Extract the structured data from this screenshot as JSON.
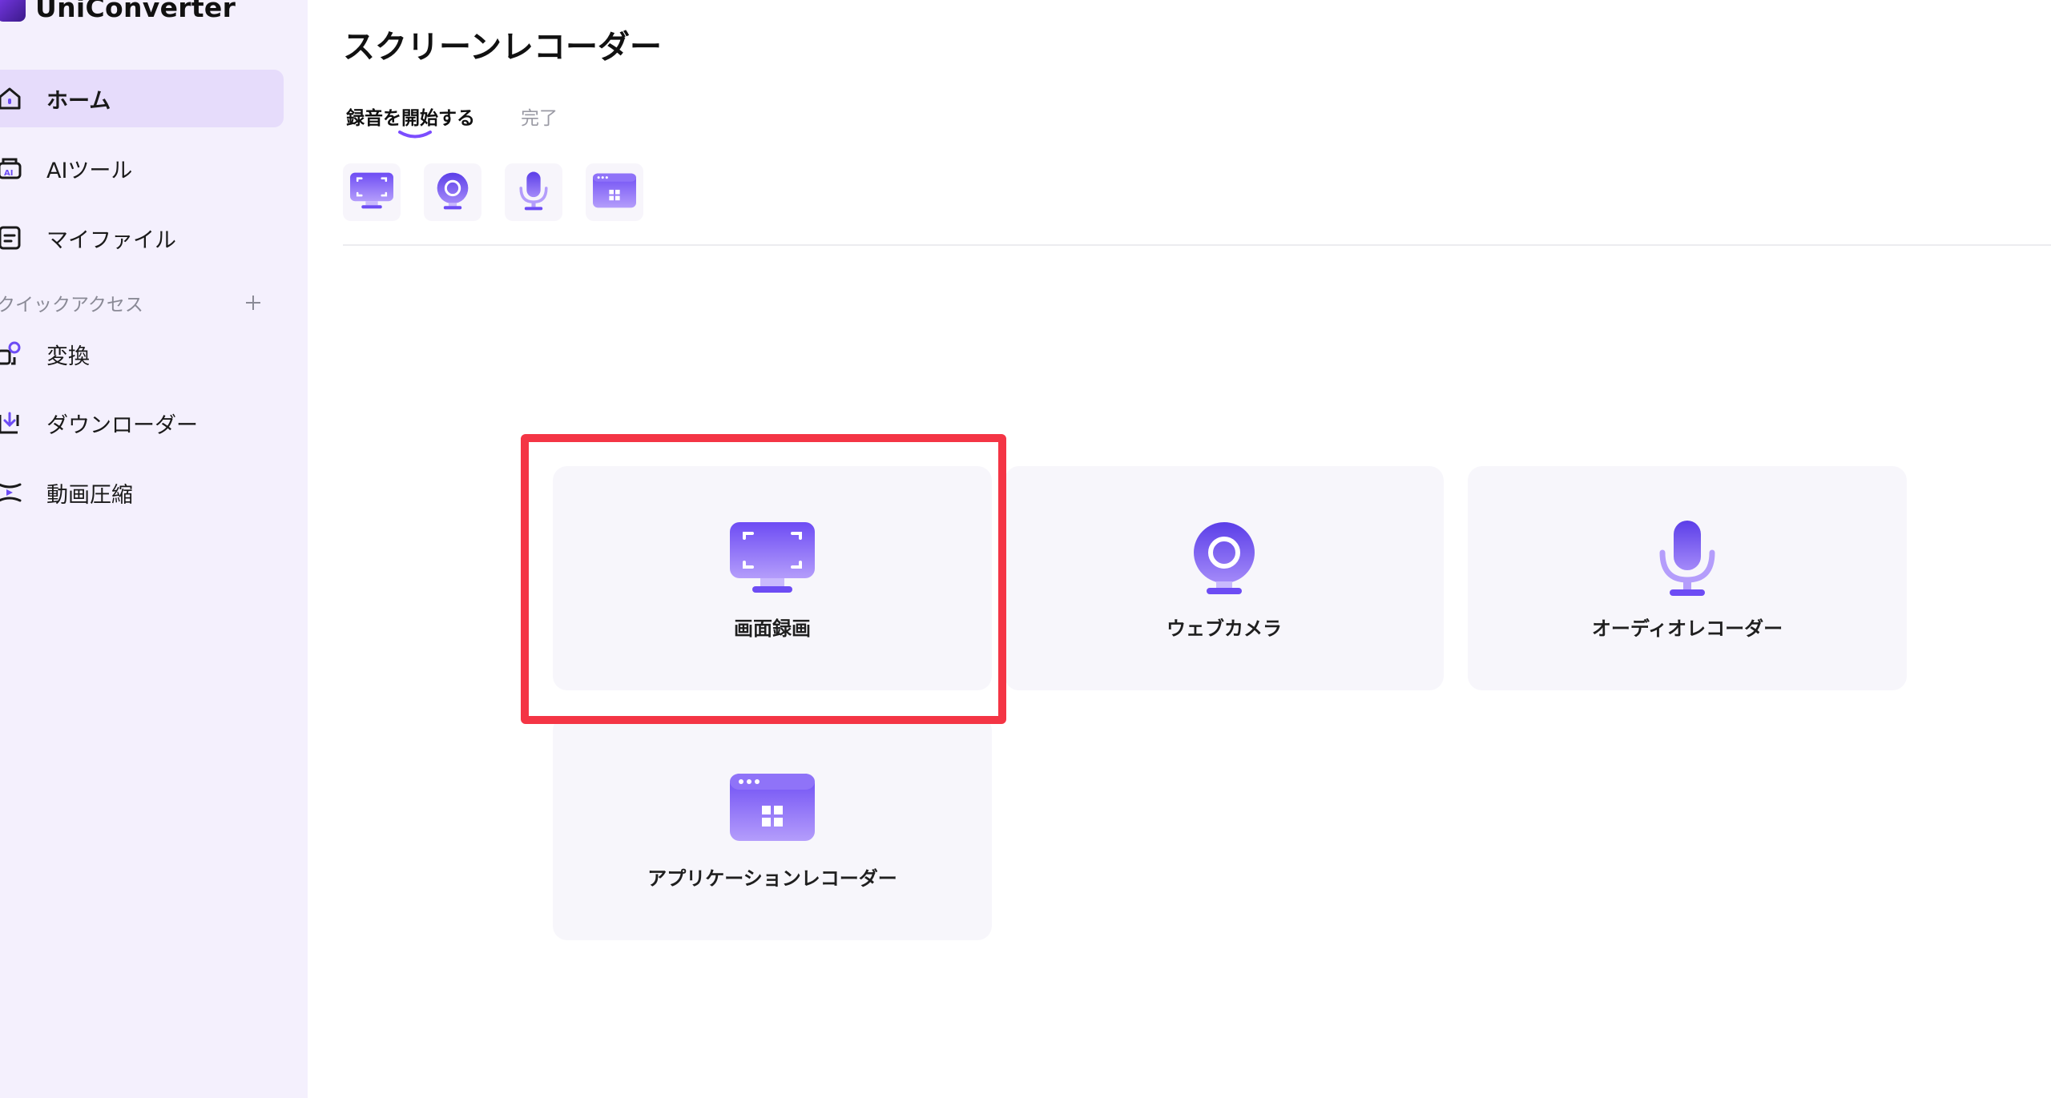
{
  "app": {
    "name": "UniConverter"
  },
  "sidebar": {
    "items": [
      {
        "label": "ホーム",
        "icon": "home-icon"
      },
      {
        "label": "AIツール",
        "icon": "ai-tools-icon"
      },
      {
        "label": "マイファイル",
        "icon": "my-files-icon"
      }
    ],
    "quick_access": {
      "label": "クイックアクセス",
      "items": [
        {
          "label": "変換",
          "icon": "convert-icon"
        },
        {
          "label": "ダウンローダー",
          "icon": "downloader-icon"
        },
        {
          "label": "動画圧縮",
          "icon": "compress-icon"
        }
      ]
    }
  },
  "main": {
    "title": "スクリーンレコーダー",
    "tabs": [
      {
        "label": "録音を開始する"
      },
      {
        "label": "完了"
      }
    ],
    "cards": [
      {
        "label": "画面録画",
        "icon": "screen-record-icon"
      },
      {
        "label": "ウェブカメラ",
        "icon": "webcam-icon"
      },
      {
        "label": "オーディオレコーダー",
        "icon": "microphone-icon"
      },
      {
        "label": "アプリケーションレコーダー",
        "icon": "app-window-icon"
      }
    ]
  },
  "colors": {
    "accent": "#7c4dff",
    "sidebar_bg": "#f4f0fd",
    "active_bg": "#e6dcfb",
    "highlight": "#f43545"
  }
}
